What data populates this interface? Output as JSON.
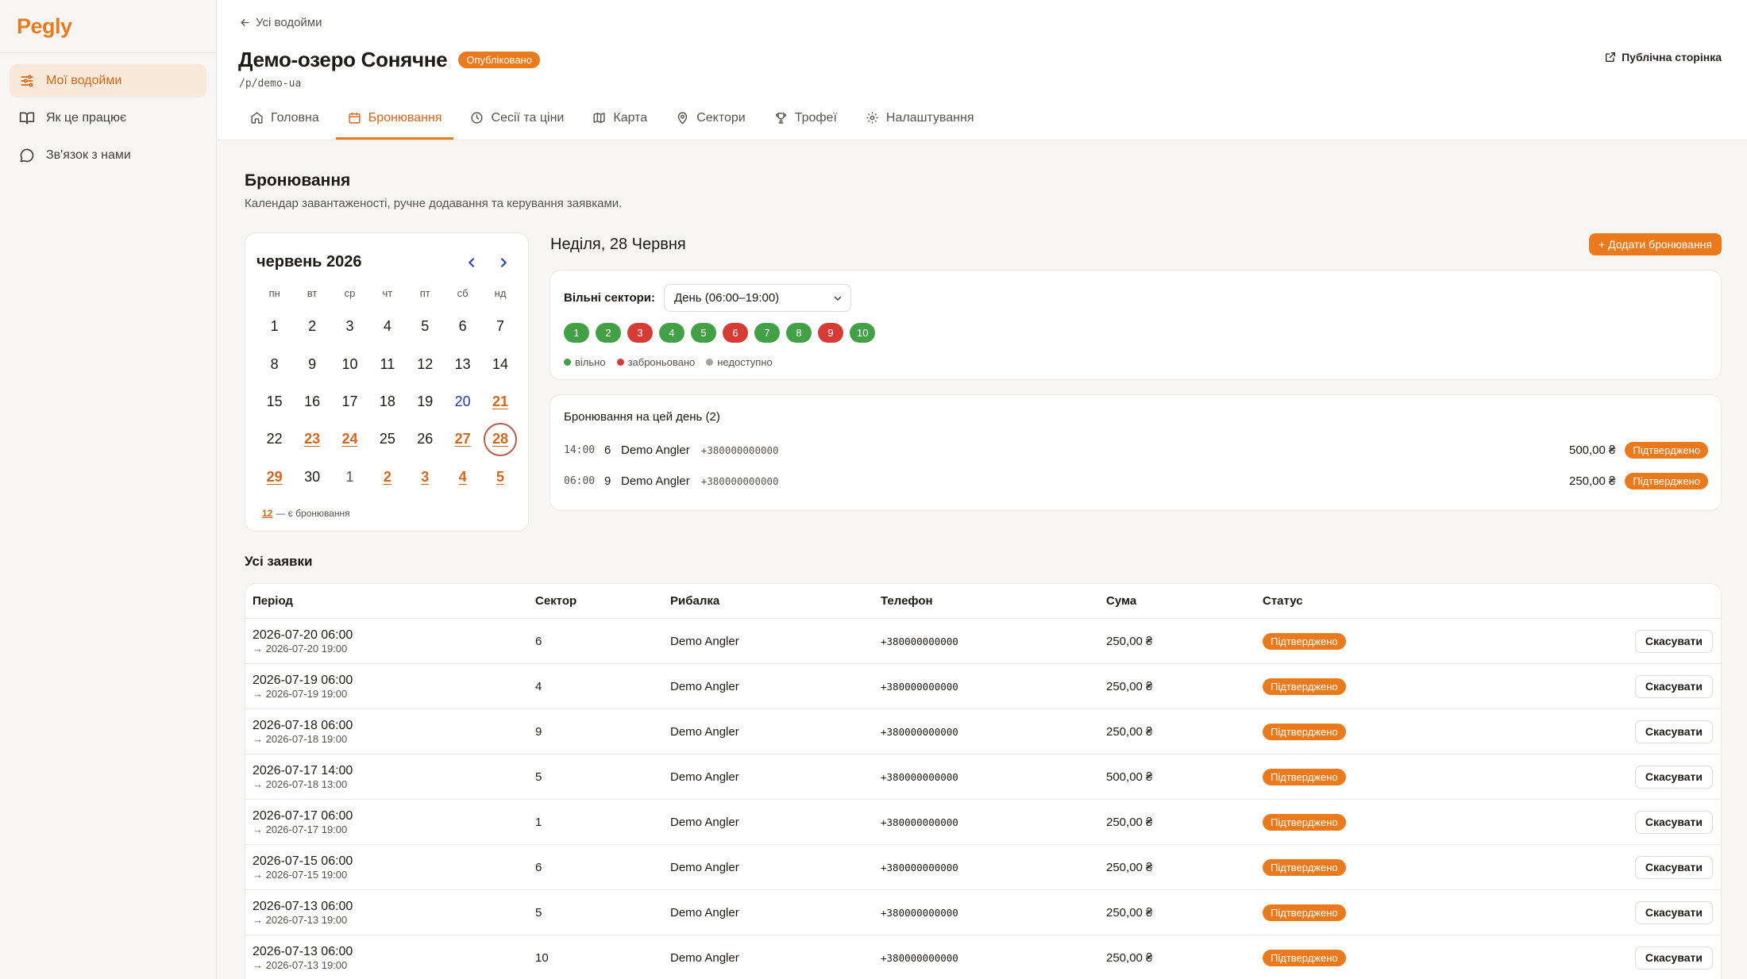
{
  "app": {
    "logo": "Pegly"
  },
  "sidebar": {
    "items": [
      {
        "label": "Мої водойми",
        "icon": "sliders-icon",
        "active": true
      },
      {
        "label": "Як це працює",
        "icon": "book-icon",
        "active": false
      },
      {
        "label": "Зв'язок з нами",
        "icon": "chat-icon",
        "active": false
      }
    ]
  },
  "header": {
    "back_label": "Усі водойми",
    "title": "Демо-озеро Сонячне",
    "status_badge": "Опубліковано",
    "slug": "/p/demo-ua",
    "public_link": "Публічна сторінка",
    "tabs": [
      {
        "label": "Головна",
        "icon": "home-icon"
      },
      {
        "label": "Бронювання",
        "icon": "calendar-icon",
        "active": true
      },
      {
        "label": "Сесії та ціни",
        "icon": "clock-icon"
      },
      {
        "label": "Карта",
        "icon": "map-icon"
      },
      {
        "label": "Сектори",
        "icon": "pin-icon"
      },
      {
        "label": "Трофеї",
        "icon": "trophy-icon"
      },
      {
        "label": "Налаштування",
        "icon": "gear-icon"
      }
    ]
  },
  "page": {
    "title": "Бронювання",
    "subtitle": "Календар завантаженості, ручне додавання та керування заявками."
  },
  "calendar": {
    "month_label": "червень 2026",
    "weekdays": [
      "пн",
      "вт",
      "ср",
      "чт",
      "пт",
      "сб",
      "нд"
    ],
    "days": [
      {
        "d": "1"
      },
      {
        "d": "2"
      },
      {
        "d": "3"
      },
      {
        "d": "4"
      },
      {
        "d": "5"
      },
      {
        "d": "6"
      },
      {
        "d": "7"
      },
      {
        "d": "8"
      },
      {
        "d": "9"
      },
      {
        "d": "10"
      },
      {
        "d": "11"
      },
      {
        "d": "12"
      },
      {
        "d": "13"
      },
      {
        "d": "14"
      },
      {
        "d": "15"
      },
      {
        "d": "16"
      },
      {
        "d": "17"
      },
      {
        "d": "18"
      },
      {
        "d": "19"
      },
      {
        "d": "20",
        "today": true
      },
      {
        "d": "21",
        "booked": true
      },
      {
        "d": "22"
      },
      {
        "d": "23",
        "booked": true
      },
      {
        "d": "24",
        "booked": true
      },
      {
        "d": "25"
      },
      {
        "d": "26"
      },
      {
        "d": "27",
        "booked": true
      },
      {
        "d": "28",
        "booked": true,
        "selected": true
      },
      {
        "d": "29",
        "booked": true
      },
      {
        "d": "30"
      },
      {
        "d": "1",
        "muted": true
      },
      {
        "d": "2",
        "muted": true,
        "booked": true
      },
      {
        "d": "3",
        "muted": true,
        "booked": true
      },
      {
        "d": "4",
        "muted": true,
        "booked": true
      },
      {
        "d": "5",
        "muted": true,
        "booked": true
      }
    ],
    "legend_sample": "12",
    "legend_text": "— є бронювання"
  },
  "day_panel": {
    "title": "Неділя, 28 Червня",
    "add_button": "+ Додати бронювання",
    "free_sectors_label": "Вільні сектори:",
    "session_select": "День (06:00–19:00)",
    "sectors": [
      {
        "n": "1",
        "state": "free"
      },
      {
        "n": "2",
        "state": "free"
      },
      {
        "n": "3",
        "state": "booked"
      },
      {
        "n": "4",
        "state": "free"
      },
      {
        "n": "5",
        "state": "free"
      },
      {
        "n": "6",
        "state": "booked"
      },
      {
        "n": "7",
        "state": "free"
      },
      {
        "n": "8",
        "state": "free"
      },
      {
        "n": "9",
        "state": "booked"
      },
      {
        "n": "10",
        "state": "free"
      }
    ],
    "legend": {
      "free": "вільно",
      "booked": "заброньовано",
      "unavailable": "недоступно"
    },
    "colors": {
      "free": "#43a047",
      "booked": "#d63b35",
      "unavailable": "#a8a29e",
      "accent": "#ea7a1c"
    }
  },
  "day_bookings": {
    "title": "Бронювання на цей день (2)",
    "rows": [
      {
        "time": "14:00",
        "sector": "6",
        "name": "Demo Angler",
        "phone": "+380000000000",
        "amount": "500,00 ₴",
        "status": "Підтверджено"
      },
      {
        "time": "06:00",
        "sector": "9",
        "name": "Demo Angler",
        "phone": "+380000000000",
        "amount": "250,00 ₴",
        "status": "Підтверджено"
      }
    ]
  },
  "requests": {
    "title": "Усі заявки",
    "columns": [
      "Період",
      "Сектор",
      "Рибалка",
      "Телефон",
      "Сума",
      "Статус"
    ],
    "cancel_label": "Скасувати",
    "rows": [
      {
        "start": "2026-07-20 06:00",
        "end": "→ 2026-07-20 19:00",
        "sector": "6",
        "name": "Demo Angler",
        "phone": "+380000000000",
        "amount": "250,00 ₴",
        "status": "Підтверджено"
      },
      {
        "start": "2026-07-19 06:00",
        "end": "→ 2026-07-19 19:00",
        "sector": "4",
        "name": "Demo Angler",
        "phone": "+380000000000",
        "amount": "250,00 ₴",
        "status": "Підтверджено"
      },
      {
        "start": "2026-07-18 06:00",
        "end": "→ 2026-07-18 19:00",
        "sector": "9",
        "name": "Demo Angler",
        "phone": "+380000000000",
        "amount": "250,00 ₴",
        "status": "Підтверджено"
      },
      {
        "start": "2026-07-17 14:00",
        "end": "→ 2026-07-18 13:00",
        "sector": "5",
        "name": "Demo Angler",
        "phone": "+380000000000",
        "amount": "500,00 ₴",
        "status": "Підтверджено"
      },
      {
        "start": "2026-07-17 06:00",
        "end": "→ 2026-07-17 19:00",
        "sector": "1",
        "name": "Demo Angler",
        "phone": "+380000000000",
        "amount": "250,00 ₴",
        "status": "Підтверджено"
      },
      {
        "start": "2026-07-15 06:00",
        "end": "→ 2026-07-15 19:00",
        "sector": "6",
        "name": "Demo Angler",
        "phone": "+380000000000",
        "amount": "250,00 ₴",
        "status": "Підтверджено"
      },
      {
        "start": "2026-07-13 06:00",
        "end": "→ 2026-07-13 19:00",
        "sector": "5",
        "name": "Demo Angler",
        "phone": "+380000000000",
        "amount": "250,00 ₴",
        "status": "Підтверджено"
      },
      {
        "start": "2026-07-13 06:00",
        "end": "→ 2026-07-13 19:00",
        "sector": "10",
        "name": "Demo Angler",
        "phone": "+380000000000",
        "amount": "250,00 ₴",
        "status": "Підтверджено"
      }
    ]
  }
}
